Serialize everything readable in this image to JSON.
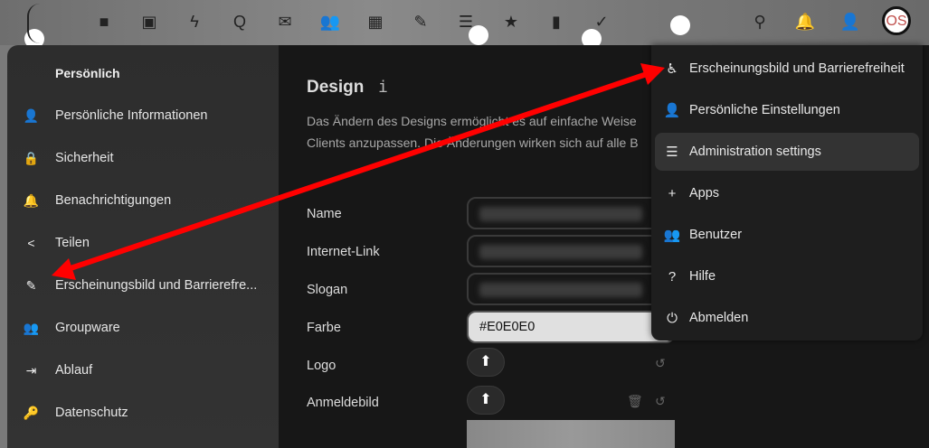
{
  "topbar": {
    "apps": [
      "files-icon",
      "photos-icon",
      "activity-icon",
      "talk-icon",
      "mail-icon",
      "contacts-icon",
      "calendar-icon",
      "notes-icon",
      "deck-icon",
      "bookmarks-icon",
      "analytics-icon",
      "tasks-icon"
    ],
    "avatar": "OS"
  },
  "sidebar": {
    "heading": "Persönlich",
    "items": [
      {
        "label": "Persönliche Informationen",
        "icon": "👤"
      },
      {
        "label": "Sicherheit",
        "icon": "🔒"
      },
      {
        "label": "Benachrichtigungen",
        "icon": "🔔"
      },
      {
        "label": "Teilen",
        "icon": "<"
      },
      {
        "label": "Erscheinungsbild und Barrierefre...",
        "icon": "✎"
      },
      {
        "label": "Groupware",
        "icon": "👥"
      },
      {
        "label": "Ablauf",
        "icon": "⇥"
      },
      {
        "label": "Datenschutz",
        "icon": "🔑"
      }
    ]
  },
  "main": {
    "title": "Design",
    "info": "i",
    "description_1": "Das Ändern des Designs ermöglicht es auf einfache Weise",
    "description_2": "Clients anzupassen. Die Änderungen wirken sich auf alle B",
    "labels": {
      "name": "Name",
      "link": "Internet-Link",
      "slogan": "Slogan",
      "color": "Farbe",
      "logo": "Logo",
      "background": "Anmeldebild"
    },
    "color_value": "#E0E0E0"
  },
  "menu": {
    "items": [
      {
        "label": "Erscheinungsbild und Barrierefreiheit",
        "icon": "♿"
      },
      {
        "label": "Persönliche Einstellungen",
        "icon": "👤"
      },
      {
        "label": "Administration settings",
        "icon": "☰"
      },
      {
        "label": "Apps",
        "icon": "+"
      },
      {
        "label": "Benutzer",
        "icon": "👥"
      },
      {
        "label": "Hilfe",
        "icon": "?"
      },
      {
        "label": "Abmelden",
        "icon": "⏻"
      }
    ]
  },
  "colors": {
    "annotation": "#ff0000",
    "menu_bg": "#1e1e1e"
  }
}
